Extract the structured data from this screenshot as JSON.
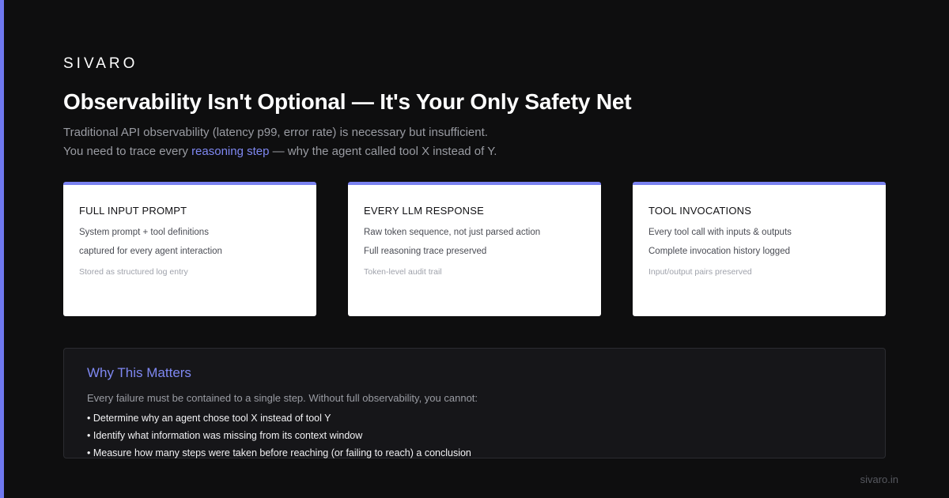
{
  "brand": "SIVARO",
  "title": "Observability Isn't Optional — It's Your Only Safety Net",
  "subtitle": {
    "line1": "Traditional API observability (latency p99, error rate) is necessary but insufficient.",
    "line2_prefix": "You need to trace every ",
    "line2_highlight": "reasoning step",
    "line2_suffix": " — why the agent called tool X instead of Y."
  },
  "cards": [
    {
      "title": "FULL INPUT PROMPT",
      "lines": [
        "System prompt + tool definitions",
        "captured for every agent interaction"
      ],
      "note": "Stored as structured log entry"
    },
    {
      "title": "EVERY LLM RESPONSE",
      "lines": [
        "Raw token sequence, not just parsed action",
        "Full reasoning trace preserved"
      ],
      "note": "Token-level audit trail"
    },
    {
      "title": "TOOL INVOCATIONS",
      "lines": [
        "Every tool call with inputs & outputs",
        "Complete invocation history logged"
      ],
      "note": "Input/output pairs preserved"
    }
  ],
  "panel": {
    "title": "Why This Matters",
    "text": "Every failure must be contained to a single step. Without full observability, you cannot:",
    "items": [
      "• Determine why an agent chose tool X instead of tool Y",
      "• Identify what information was missing from its context window",
      "• Measure how many steps were taken before reaching (or failing to reach) a conclusion"
    ]
  },
  "footer": "sivaro.in",
  "colors": {
    "background": "#0e0e0f",
    "accent": "#6f78f0",
    "highlight": "#7f88f2",
    "card_bg": "#ffffff"
  }
}
